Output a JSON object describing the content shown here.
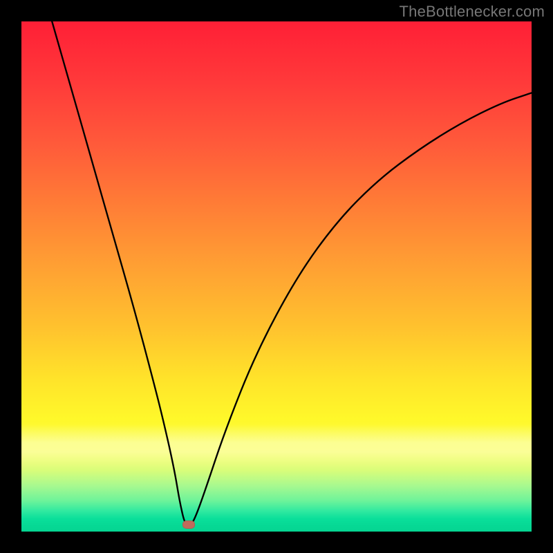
{
  "watermark": "TheBottlenecker.com",
  "marker": {
    "x_pct": 32.8,
    "y_pct": 98.6,
    "color": "#c06a5c"
  },
  "chart_data": {
    "type": "line",
    "title": "",
    "xlabel": "",
    "ylabel": "",
    "xlim": [
      0,
      100
    ],
    "ylim": [
      0,
      100
    ],
    "grid": false,
    "legend": false,
    "background": "red-yellow-green vertical gradient",
    "marker_point": {
      "x": 33,
      "y": 1
    },
    "series": [
      {
        "name": "curve",
        "color": "#000000",
        "x": [
          6,
          10,
          14,
          18,
          22,
          26,
          28,
          30,
          31,
          32,
          33,
          34,
          36,
          40,
          46,
          54,
          62,
          70,
          78,
          86,
          94,
          100
        ],
        "y": [
          100,
          86,
          72,
          58,
          44,
          29,
          21,
          12,
          6,
          1.5,
          1,
          2.5,
          8,
          20,
          35,
          50,
          61,
          69,
          75,
          80,
          84,
          86
        ]
      }
    ],
    "notes": "Axes are unlabeled in the source image; values are read as percentage of plot area (0 at bottom/left, 100 at top/right). Curve has a sharp V-shaped minimum near x≈33 then rises with decreasing slope toward the right edge."
  }
}
